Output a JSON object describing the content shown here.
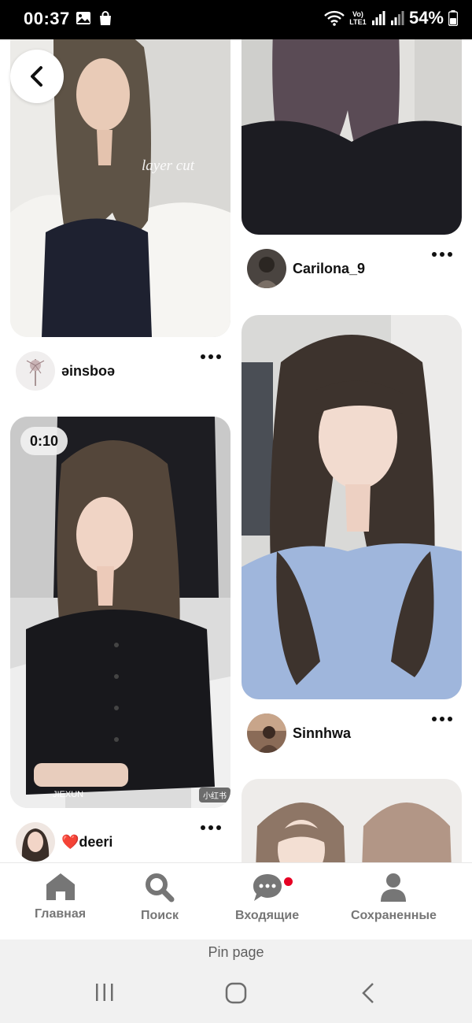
{
  "status_bar": {
    "time": "00:37",
    "battery": "54%",
    "network_label": "Vo) LTE1"
  },
  "pins": [
    {
      "author": "əinsboə",
      "image_watermark": "layer cut"
    },
    {
      "author": "Carilona_9"
    },
    {
      "author": "❤️deeri",
      "video_duration": "0:10",
      "image_watermark": "JIEXUN",
      "image_badge": "小红书"
    },
    {
      "author": "Sinnhwa"
    },
    {
      "author": ""
    }
  ],
  "bottom_nav": {
    "home": "Главная",
    "search": "Поиск",
    "inbox": "Входящие",
    "saved": "Сохраненные"
  },
  "page_label": "Pin page",
  "colors": {
    "accent": "#e60023",
    "nav_icon": "#767676",
    "status_bar_bg": "#000000"
  },
  "icons": [
    "back-arrow-icon",
    "more-icon",
    "home-icon",
    "search-icon",
    "chat-icon",
    "profile-icon",
    "recents-icon",
    "home-circle-icon",
    "back-chevron-icon",
    "wifi-icon",
    "signal-icon",
    "battery-icon",
    "gallery-icon",
    "bag-icon"
  ]
}
